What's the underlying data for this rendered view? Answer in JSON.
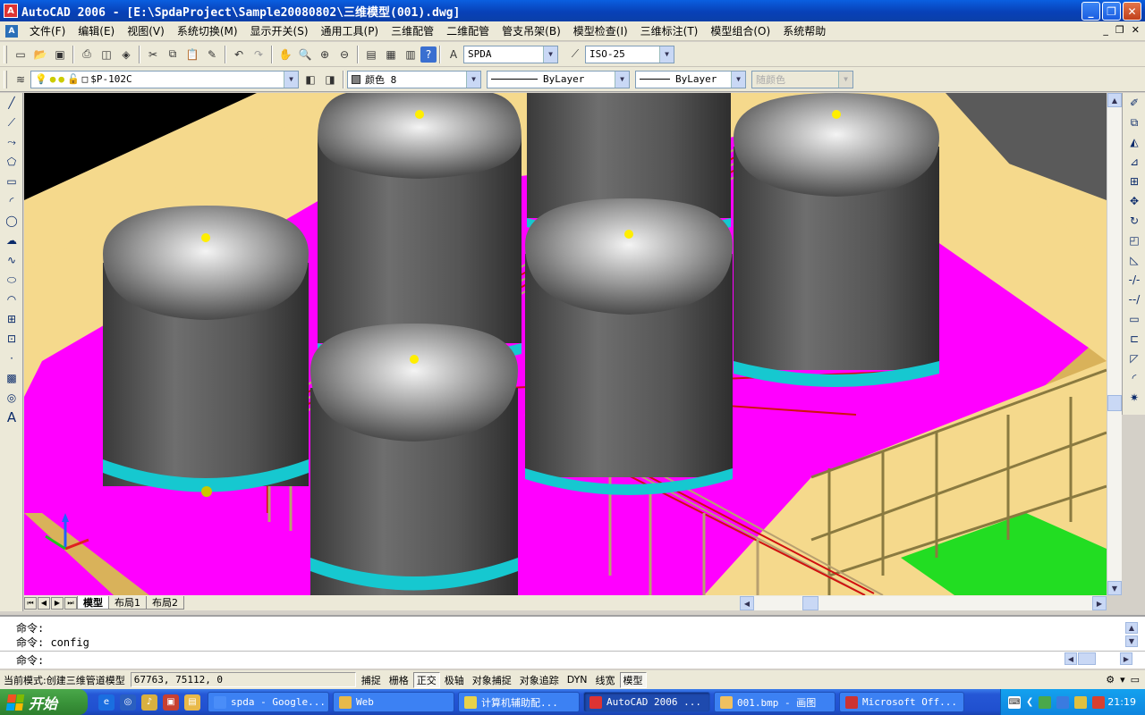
{
  "window": {
    "title": "AutoCAD 2006 - [E:\\SpdaProject\\Sample20080802\\三维模型(001).dwg]"
  },
  "menu": [
    "文件(F)",
    "编辑(E)",
    "视图(V)",
    "系统切换(M)",
    "显示开关(S)",
    "通用工具(P)",
    "三维配管",
    "二维配管",
    "管支吊架(B)",
    "模型检查(I)",
    "三维标注(T)",
    "模型组合(O)",
    "系统帮助"
  ],
  "toolbar": {
    "textstyle": "SPDA",
    "dimstyle": "ISO-25",
    "layer": "$P-102C",
    "color": "颜色 8",
    "linetype": "ByLayer",
    "lineweight": "ByLayer",
    "plotstyle": "随颜色"
  },
  "layout_tabs": [
    "模型",
    "布局1",
    "布局2"
  ],
  "command": {
    "line1": "命令:",
    "line2": "命令:  config",
    "prompt": "命令:"
  },
  "status": {
    "mode": "当前模式:创建三维管道模型",
    "coords": "67763, 75112, 0",
    "toggles": [
      {
        "label": "捕捉",
        "on": false
      },
      {
        "label": "栅格",
        "on": false
      },
      {
        "label": "正交",
        "on": true
      },
      {
        "label": "极轴",
        "on": false
      },
      {
        "label": "对象捕捉",
        "on": false
      },
      {
        "label": "对象追踪",
        "on": false
      },
      {
        "label": "DYN",
        "on": false
      },
      {
        "label": "线宽",
        "on": false
      },
      {
        "label": "模型",
        "on": true
      }
    ]
  },
  "taskbar": {
    "start": "开始",
    "tasks": [
      {
        "label": "spda - Google...",
        "color": "#4a8df8",
        "active": false
      },
      {
        "label": "Web",
        "color": "#e8b94a",
        "active": false
      },
      {
        "label": "计算机辅助配...",
        "color": "#e8d24a",
        "active": false
      },
      {
        "label": "AutoCAD 2006 ...",
        "color": "#d33",
        "active": true
      },
      {
        "label": "001.bmp - 画图",
        "color": "#f0c060",
        "active": false
      },
      {
        "label": "Microsoft Off...",
        "color": "#c33",
        "active": false
      }
    ],
    "clock": "21:19"
  },
  "colors": {
    "floor": "#ff00ff",
    "concrete": "#f5d98c",
    "tank": "#5a5a5a",
    "tank_base": "#16c8d0",
    "pipe": "#d01010",
    "steel": "#b8a070",
    "grating": "#22dd22"
  }
}
